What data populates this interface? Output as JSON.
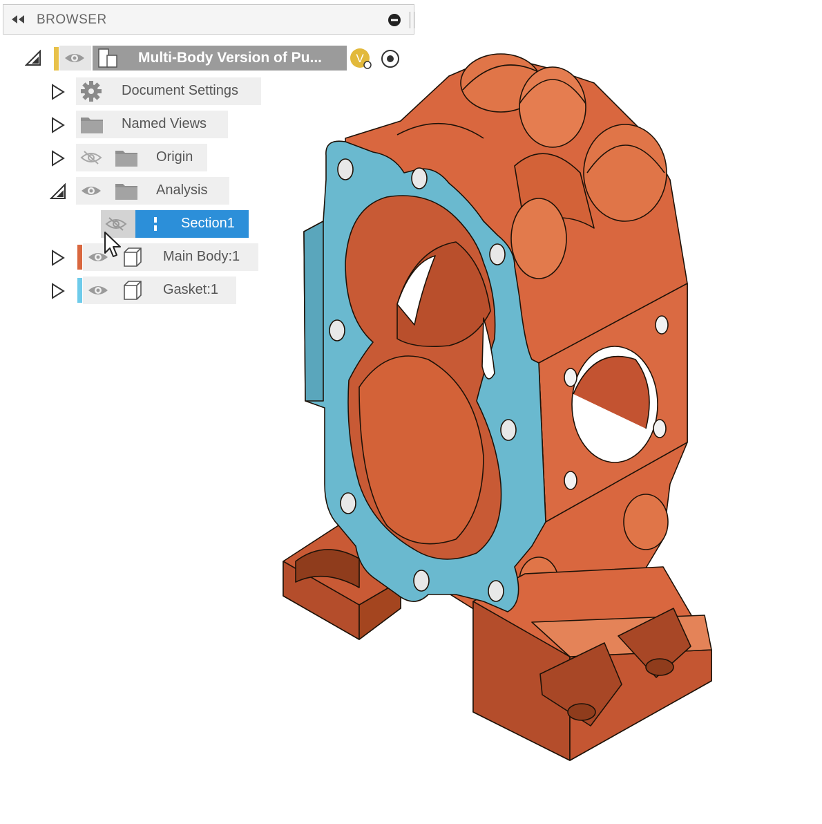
{
  "browser": {
    "title": "BROWSER",
    "root": {
      "label": "Multi-Body Version of Pu...",
      "version_badge": "V"
    },
    "items": [
      {
        "label": "Document Settings",
        "icon": "gear-icon",
        "expanded": false
      },
      {
        "label": "Named Views",
        "icon": "folder-icon",
        "expanded": false
      },
      {
        "label": "Origin",
        "icon": "folder-icon",
        "visible": false,
        "expanded": false
      },
      {
        "label": "Analysis",
        "icon": "folder-icon",
        "visible": true,
        "expanded": true,
        "children": [
          {
            "label": "Section1",
            "icon": "section-analysis-icon",
            "visible": false,
            "selected": true
          }
        ]
      },
      {
        "label": "Main Body:1",
        "icon": "body-icon",
        "visible": true,
        "color": "#d9673f",
        "expanded": false
      },
      {
        "label": "Gasket:1",
        "icon": "body-icon",
        "visible": true,
        "color": "#6ecbea",
        "expanded": false
      }
    ]
  },
  "colors": {
    "body": "#d9673f",
    "gasket": "#6ab9cf",
    "selection": "#2c8fd9",
    "root_accent": "#e8c14a"
  }
}
